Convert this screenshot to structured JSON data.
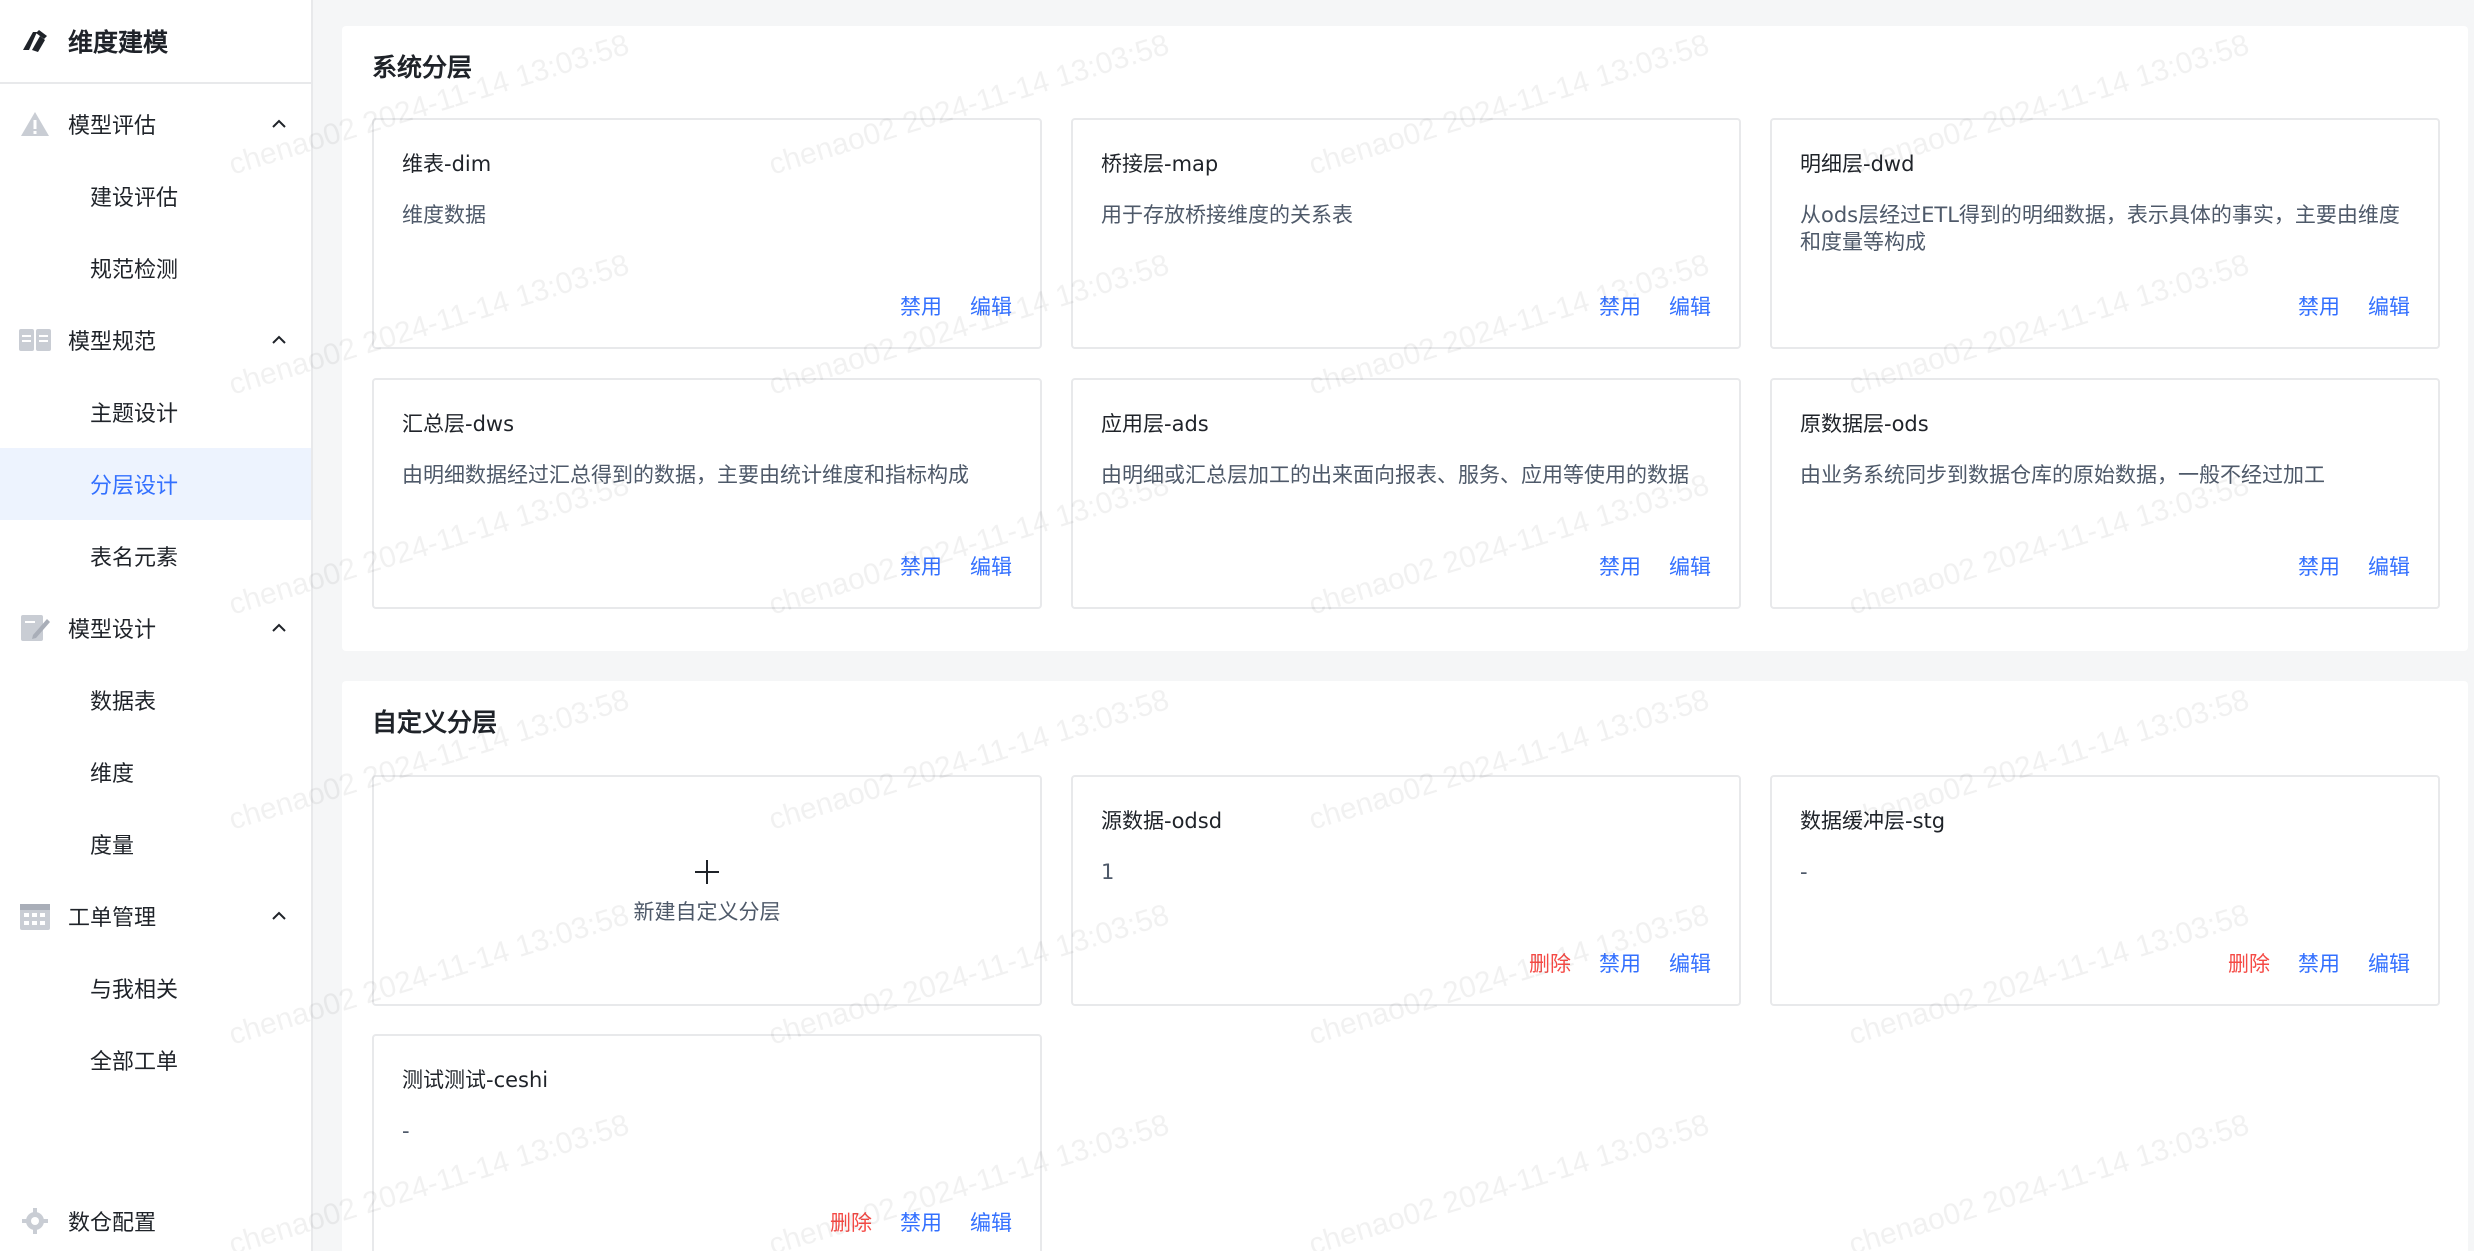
{
  "sidebar": {
    "title": "维度建模",
    "groups": [
      {
        "label": "模型评估",
        "icon": "triangle-warning-icon",
        "items": [
          "建设评估",
          "规范检测"
        ]
      },
      {
        "label": "模型规范",
        "icon": "book-icon",
        "items": [
          "主题设计",
          "分层设计",
          "表名元素"
        ]
      },
      {
        "label": "模型设计",
        "icon": "edit-pencil-icon",
        "items": [
          "数据表",
          "维度",
          "度量"
        ]
      },
      {
        "label": "工单管理",
        "icon": "calendar-grid-icon",
        "items": [
          "与我相关",
          "全部工单"
        ]
      }
    ],
    "active_item": "分层设计",
    "footer": {
      "label": "数仓配置",
      "icon": "gear-icon"
    }
  },
  "system_layers": {
    "title": "系统分层",
    "cards": [
      {
        "name": "维表-dim",
        "desc": "维度数据",
        "actions": [
          "禁用",
          "编辑"
        ]
      },
      {
        "name": "桥接层-map",
        "desc": "用于存放桥接维度的关系表",
        "actions": [
          "禁用",
          "编辑"
        ]
      },
      {
        "name": "明细层-dwd",
        "desc": "从ods层经过ETL得到的明细数据，表示具体的事实，主要由维度和度量等构成",
        "actions": [
          "禁用",
          "编辑"
        ]
      },
      {
        "name": "汇总层-dws",
        "desc": "由明细数据经过汇总得到的数据，主要由统计维度和指标构成",
        "actions": [
          "禁用",
          "编辑"
        ]
      },
      {
        "name": "应用层-ads",
        "desc": "由明细或汇总层加工的出来面向报表、服务、应用等使用的数据",
        "actions": [
          "禁用",
          "编辑"
        ]
      },
      {
        "name": "原数据层-ods",
        "desc": "由业务系统同步到数据仓库的原始数据，一般不经过加工",
        "actions": [
          "禁用",
          "编辑"
        ]
      }
    ]
  },
  "custom_layers": {
    "title": "自定义分层",
    "new_label": "新建自定义分层",
    "cards": [
      {
        "name": "源数据-odsd",
        "desc": "1",
        "actions": [
          "删除",
          "禁用",
          "编辑"
        ]
      },
      {
        "name": "数据缓冲层-stg",
        "desc": "-",
        "actions": [
          "删除",
          "禁用",
          "编辑"
        ]
      },
      {
        "name": "测试测试-ceshi",
        "desc": "-",
        "actions": [
          "删除",
          "禁用",
          "编辑"
        ]
      }
    ]
  },
  "watermark": "chenao02 2024-11-14 13:03:58",
  "colors": {
    "accent": "#3370ff",
    "danger": "#f54a45",
    "active_bg": "#edf3fe",
    "border": "#e8e9eb",
    "page_bg": "#f5f6f7"
  }
}
